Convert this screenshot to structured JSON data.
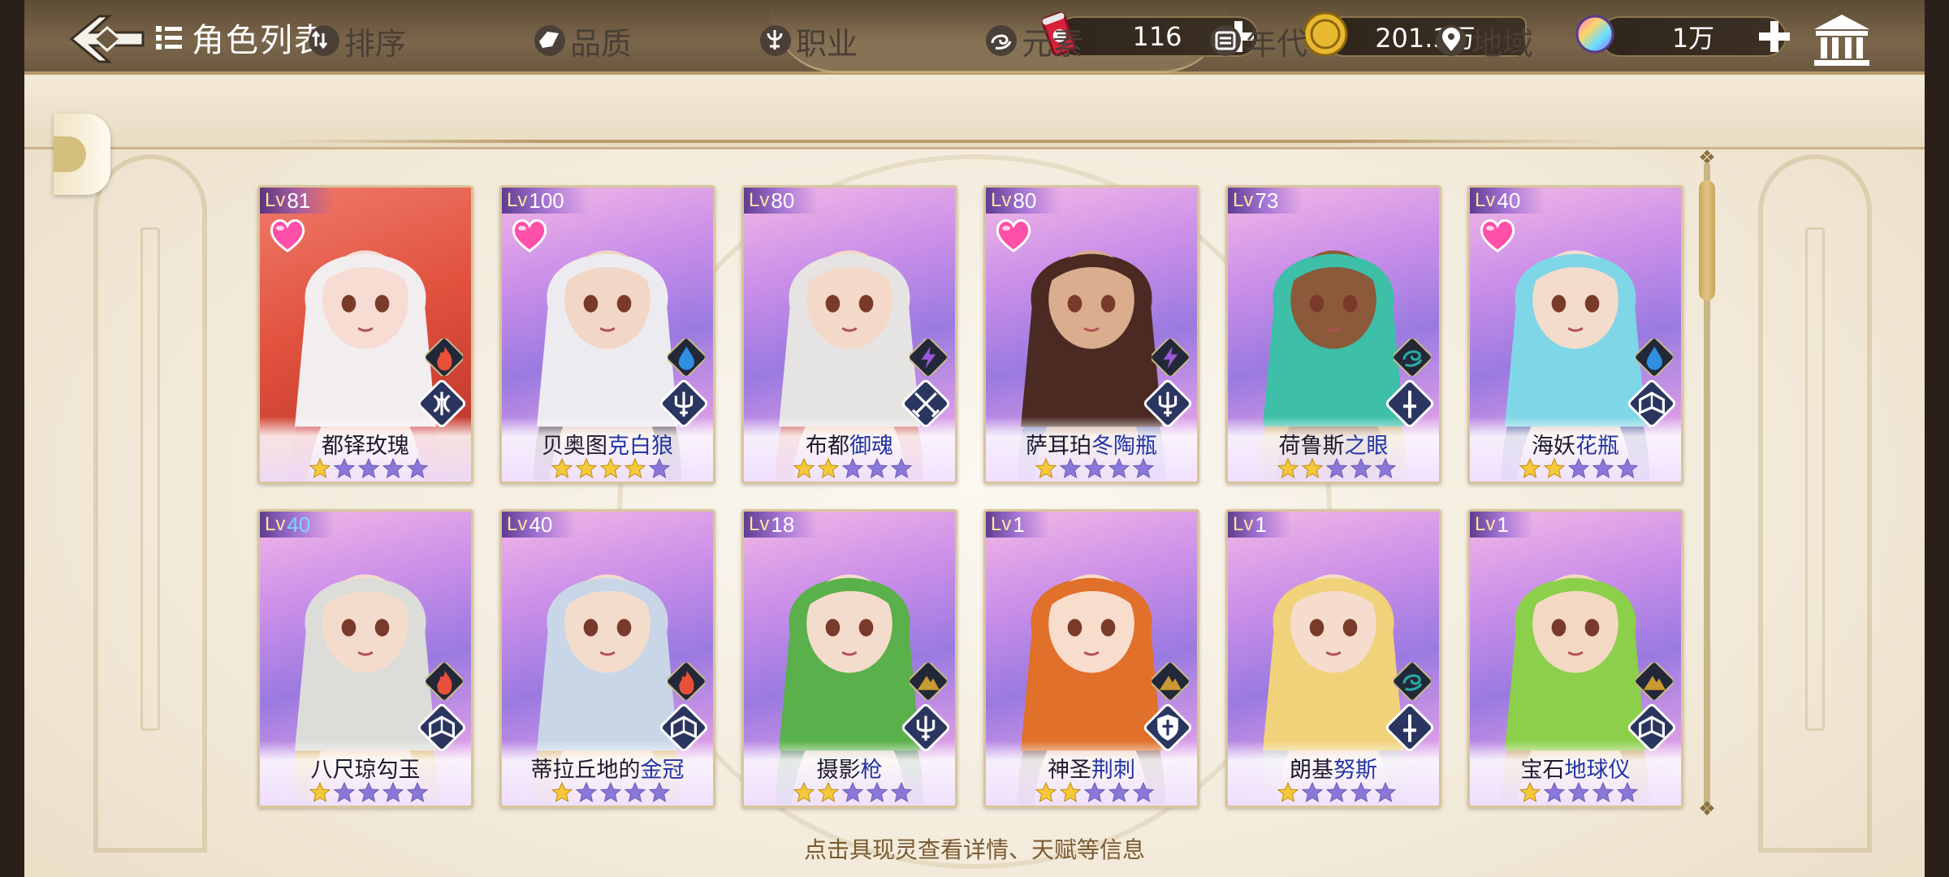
{
  "header": {
    "title": "角色列表",
    "resources": [
      {
        "name": "stamina",
        "icon": "soda-can-icon",
        "value": "116"
      },
      {
        "name": "gold",
        "icon": "gold-coin-icon",
        "value": "201.3万"
      },
      {
        "name": "gems",
        "icon": "rainbow-gem-icon",
        "value": "1万"
      }
    ]
  },
  "filters": [
    {
      "label": "排序",
      "icon": "sort-icon"
    },
    {
      "label": "品质",
      "icon": "quality-icon"
    },
    {
      "label": "职业",
      "icon": "profession-icon"
    },
    {
      "label": "元素",
      "icon": "element-icon"
    },
    {
      "label": "年代",
      "icon": "era-icon"
    },
    {
      "label": "地域",
      "icon": "location-pin-icon"
    }
  ],
  "characters": [
    {
      "lv_prefix": "Lv",
      "level": "81",
      "name_a": "都铎玫瑰",
      "name_b": "",
      "stars": 1,
      "favorite": true,
      "element": "fire",
      "class": "bow",
      "frame": "red",
      "hair": "#f2eef0",
      "skin": "#f6dcd2",
      "accent": "#c8202c"
    },
    {
      "lv_prefix": "Lv",
      "level": "100",
      "name_a": "贝奥图",
      "name_b": "克白狼",
      "stars": 4,
      "favorite": true,
      "element": "water",
      "class": "trident",
      "frame": "purple",
      "hair": "#ececf0",
      "skin": "#f2d6c6",
      "accent": "#24181a"
    },
    {
      "lv_prefix": "Lv",
      "level": "80",
      "name_a": "布都",
      "name_b": "御魂",
      "stars": 2,
      "favorite": false,
      "element": "lightning",
      "class": "crossed-swords",
      "frame": "purple",
      "hair": "#e6e4e2",
      "skin": "#f4d8c8",
      "accent": "#c43a2c"
    },
    {
      "lv_prefix": "Lv",
      "level": "80",
      "name_a": "萨耳珀",
      "name_b": "冬陶瓶",
      "stars": 1,
      "favorite": true,
      "element": "lightning",
      "class": "trident",
      "frame": "purple",
      "hair": "#4a2a22",
      "skin": "#d9ad8e",
      "accent": "#5c6aa8"
    },
    {
      "lv_prefix": "Lv",
      "level": "73",
      "name_a": "荷鲁斯",
      "name_b": "之眼",
      "stars": 2,
      "favorite": false,
      "element": "wind",
      "class": "sword",
      "frame": "purple",
      "hair": "#3dbfa8",
      "skin": "#8a5a3a",
      "accent": "#c9a24a"
    },
    {
      "lv_prefix": "Lv",
      "level": "40",
      "name_a": "海妖",
      "name_b": "花瓶",
      "stars": 2,
      "favorite": true,
      "element": "water",
      "class": "book",
      "frame": "purple",
      "hair": "#7fd6e6",
      "skin": "#f4dccd",
      "accent": "#283a8a"
    },
    {
      "lv_prefix": "Lv",
      "level": "40",
      "lv_blue": true,
      "name_a": "八尺琼勾玉",
      "name_b": "",
      "stars": 1,
      "favorite": false,
      "element": "fire",
      "class": "book",
      "frame": "purple",
      "hair": "#dcdcd8",
      "skin": "#f4dccd",
      "accent": "#d8a838"
    },
    {
      "lv_prefix": "Lv",
      "level": "40",
      "name_a": "蒂拉丘地的",
      "name_b": "金冠",
      "stars": 1,
      "favorite": false,
      "element": "fire",
      "class": "book",
      "frame": "purple",
      "hair": "#c8d6e8",
      "skin": "#f4dccd",
      "accent": "#d8b04a"
    },
    {
      "lv_prefix": "Lv",
      "level": "18",
      "name_a": "摄影",
      "name_b": "枪",
      "stars": 2,
      "favorite": false,
      "element": "earth",
      "class": "trident",
      "frame": "purple",
      "hair": "#5ab04a",
      "skin": "#f4dccd",
      "accent": "#2f6a3a"
    },
    {
      "lv_prefix": "Lv",
      "level": "1",
      "name_a": "神圣",
      "name_b": "荆刺",
      "stars": 2,
      "favorite": false,
      "element": "earth",
      "class": "shield",
      "frame": "purple",
      "hair": "#e0702a",
      "skin": "#f8dccc",
      "accent": "#6a4a3a"
    },
    {
      "lv_prefix": "Lv",
      "level": "1",
      "name_a": "朗基",
      "name_b": "努斯",
      "stars": 1,
      "favorite": false,
      "element": "wind",
      "class": "sword",
      "frame": "purple",
      "hair": "#f0d27a",
      "skin": "#f6dccc",
      "accent": "#b8b8c4"
    },
    {
      "lv_prefix": "Lv",
      "level": "1",
      "name_a": "宝石",
      "name_b": "地球仪",
      "stars": 1,
      "favorite": false,
      "element": "earth",
      "class": "book",
      "frame": "purple",
      "hair": "#8ccf4a",
      "skin": "#f4d8c2",
      "accent": "#c08a3a"
    }
  ],
  "footer": {
    "hint": "点击具现灵查看详情、天赋等信息"
  },
  "colors": {
    "topbar": "#6b5840",
    "fire": "#e8503a",
    "water": "#2f8fe0",
    "lightning": "#9a5ad8",
    "wind": "#2aa8a0",
    "earth": "#c89a30",
    "class_badge": "#2a3560",
    "star_gold": "#f5c93a",
    "star_empty": "#8a78d8"
  },
  "icons": {
    "back": "back-arrow-icon",
    "list": "list-icon",
    "plus": "plus-icon",
    "bank": "bank-icon",
    "heart": "heart-icon"
  }
}
